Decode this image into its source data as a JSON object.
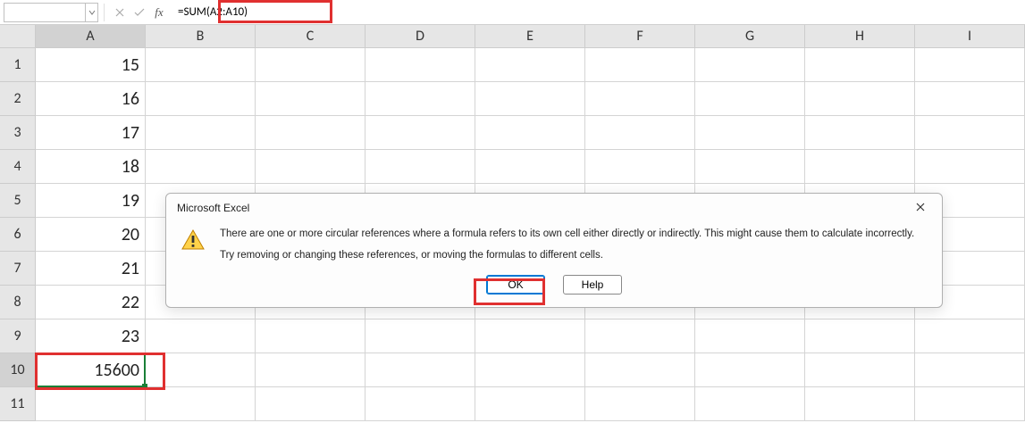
{
  "formula_bar": {
    "name_box": "",
    "formula": "=SUM(A2:A10)"
  },
  "columns": [
    "A",
    "B",
    "C",
    "D",
    "E",
    "F",
    "G",
    "H",
    "I"
  ],
  "rows": [
    "1",
    "2",
    "3",
    "4",
    "5",
    "6",
    "7",
    "8",
    "9",
    "10",
    "11"
  ],
  "selected_cell": {
    "row": 10,
    "col": "A"
  },
  "cells": {
    "A1": "15",
    "A2": "16",
    "A3": "17",
    "A4": "18",
    "A5": "19",
    "A6": "20",
    "A7": "21",
    "A8": "22",
    "A9": "23",
    "A10": "15600"
  },
  "dialog": {
    "title": "Microsoft Excel",
    "line1": "There are one or more circular references where a formula refers to its own cell either directly or indirectly. This might cause them to calculate incorrectly.",
    "line2": "Try removing or changing these references, or moving the formulas to different cells.",
    "ok": "OK",
    "help": "Help"
  }
}
